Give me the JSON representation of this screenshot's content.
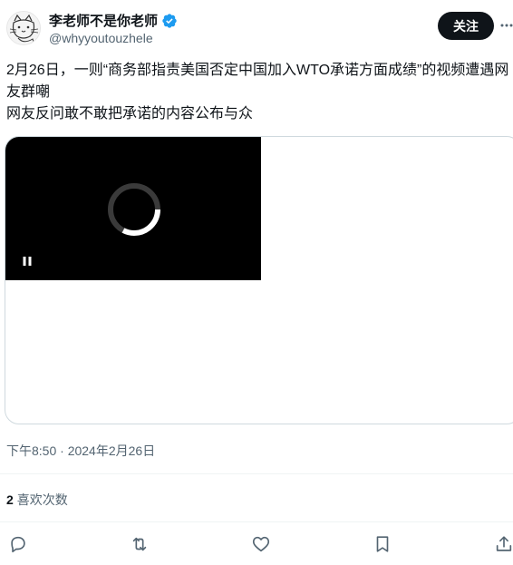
{
  "author": {
    "display_name": "李老师不是你老师",
    "handle": "@whyyoutouzhele",
    "verified": true
  },
  "header": {
    "follow_label": "关注"
  },
  "tweet": {
    "line1": "2月26日，一则“商务部指责美国否定中国加入WTO承诺方面成绩”的视频遭遇网友群嘲",
    "line2": "网友反问敢不敢把承诺的内容公布与众"
  },
  "timestamp": "下午8:50 · 2024年2月26日",
  "stats": {
    "count": "2",
    "label": "喜欢次数"
  },
  "icons": {
    "verified": "verified-badge-icon",
    "more": "more-dots-icon",
    "pause": "pause-icon",
    "reply": "reply-icon",
    "retweet": "retweet-icon",
    "like": "heart-icon",
    "bookmark": "bookmark-icon",
    "share": "share-icon"
  },
  "colors": {
    "accent": "#1d9bf0",
    "text": "#0f1419",
    "secondary": "#536471",
    "border": "#cfd9de",
    "button_bg": "#0f1419"
  }
}
